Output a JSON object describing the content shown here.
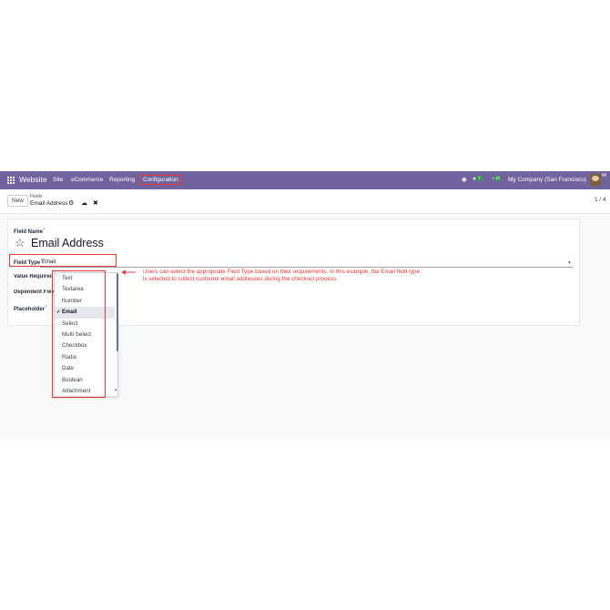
{
  "navbar": {
    "brand": "Website",
    "menu": [
      "Site",
      "eCommerce",
      "Reporting",
      "Configuration"
    ],
    "chat_count": "7",
    "activity_count": "12",
    "company": "My Company (San Francisco)",
    "user_initials": "Mi"
  },
  "control_panel": {
    "new_label": "New",
    "breadcrumb_parent": "Fields",
    "breadcrumb_current": "Email Address",
    "pager": "1 / 4"
  },
  "form": {
    "field_name_label": "Field Name",
    "field_name_value": "Email Address",
    "field_type_label": "Field Type",
    "field_type_value": "Email",
    "value_required_label": "Value Required",
    "dependent_field_label": "Dependent Field",
    "placeholder_label": "Placeholder",
    "help_mark": "?"
  },
  "dropdown": {
    "options": [
      "Text",
      "Textarea",
      "Number",
      "Email",
      "Select",
      "Multi Select",
      "Checkbox",
      "Radio",
      "Date",
      "Boolean",
      "Attachment"
    ],
    "selected": "Email",
    "check_mark": "✓"
  },
  "annotation": {
    "line1": "Users can select the appropriate Field Type based on their requirements. In this example, the Email field type",
    "line2": "is selected to collect customer email addresses during the checkout process."
  },
  "colors": {
    "navbar": "#71639e",
    "highlight": "#e53935"
  }
}
